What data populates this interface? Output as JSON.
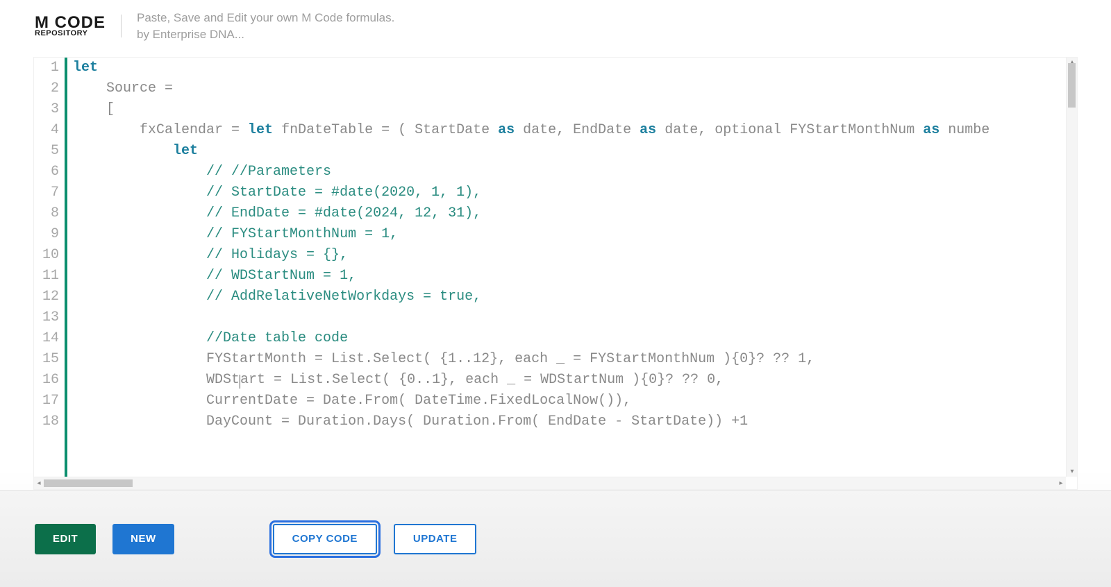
{
  "header": {
    "logo_line1": "M CODE",
    "logo_line2": "REPOSITORY",
    "tagline_line1": "Paste, Save and Edit your own M Code formulas.",
    "tagline_line2": "by Enterprise DNA..."
  },
  "editor": {
    "line_numbers": [
      "1",
      "2",
      "3",
      "4",
      "5",
      "6",
      "7",
      "8",
      "9",
      "10",
      "11",
      "12",
      "13",
      "14",
      "15",
      "16",
      "17",
      "18"
    ],
    "lines": [
      [
        [
          "kw",
          "let"
        ]
      ],
      [
        [
          "id",
          "    Source ="
        ]
      ],
      [
        [
          "id",
          "    ["
        ]
      ],
      [
        [
          "id",
          "        fxCalendar = "
        ],
        [
          "kw",
          "let"
        ],
        [
          "id",
          " fnDateTable = ( StartDate "
        ],
        [
          "kw2",
          "as"
        ],
        [
          "id",
          " date, EndDate "
        ],
        [
          "kw2",
          "as"
        ],
        [
          "id",
          " date, optional FYStartMonthNum "
        ],
        [
          "kw2",
          "as"
        ],
        [
          "id",
          " numbe"
        ]
      ],
      [
        [
          "id",
          "            "
        ],
        [
          "kw",
          "let"
        ]
      ],
      [
        [
          "id",
          "                "
        ],
        [
          "com",
          "// //Parameters"
        ]
      ],
      [
        [
          "id",
          "                "
        ],
        [
          "com",
          "// StartDate = #date(2020, 1, 1),"
        ]
      ],
      [
        [
          "id",
          "                "
        ],
        [
          "com",
          "// EndDate = #date(2024, 12, 31),"
        ]
      ],
      [
        [
          "id",
          "                "
        ],
        [
          "com",
          "// FYStartMonthNum = 1,"
        ]
      ],
      [
        [
          "id",
          "                "
        ],
        [
          "com",
          "// Holidays = {},"
        ]
      ],
      [
        [
          "id",
          "                "
        ],
        [
          "com",
          "// WDStartNum = 1,"
        ]
      ],
      [
        [
          "id",
          "                "
        ],
        [
          "com",
          "// AddRelativeNetWorkdays = true,"
        ]
      ],
      [
        [
          "id",
          ""
        ]
      ],
      [
        [
          "id",
          "                "
        ],
        [
          "com",
          "//Date table code"
        ]
      ],
      [
        [
          "id",
          "                FYStartMonth = List.Select( {1..12}, each _ = FYStartMonthNum ){0}? ?? 1,"
        ]
      ],
      [
        [
          "id",
          "                WDStart = List.Select( {0..1}, each _ = WDStartNum ){0}? ?? 0,"
        ]
      ],
      [
        [
          "id",
          "                CurrentDate = Date.From( DateTime.FixedLocalNow()),"
        ]
      ],
      [
        [
          "id",
          "                DayCount = Duration.Days( Duration.From( EndDate - StartDate)) +1"
        ]
      ]
    ],
    "caret_line_index": 15,
    "caret_after_chars": 20
  },
  "footer": {
    "edit": "EDIT",
    "new": "NEW",
    "copy": "COPY CODE",
    "update": "UPDATE"
  }
}
